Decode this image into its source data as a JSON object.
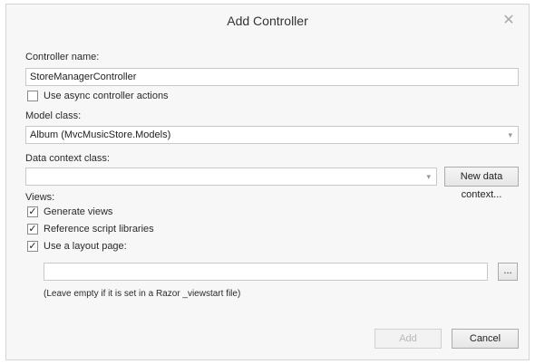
{
  "dialog": {
    "title": "Add Controller",
    "close_icon": "close-icon"
  },
  "controller_name": {
    "label": "Controller name:",
    "value": "StoreManagerController"
  },
  "async_actions": {
    "label": "Use async controller actions",
    "checked": false
  },
  "model_class": {
    "label": "Model class:",
    "value": "Album (MvcMusicStore.Models)"
  },
  "data_context": {
    "label": "Data context class:",
    "value": "",
    "new_button": "New data context..."
  },
  "views": {
    "label": "Views:",
    "generate_views": {
      "label": "Generate views",
      "checked": true
    },
    "reference_scripts": {
      "label": "Reference script libraries",
      "checked": true
    },
    "use_layout": {
      "label": "Use a layout page:",
      "checked": true
    },
    "layout_path": "",
    "browse_button": "...",
    "hint": "(Leave empty if it is set in a Razor _viewstart file)"
  },
  "buttons": {
    "add": "Add",
    "cancel": "Cancel"
  }
}
